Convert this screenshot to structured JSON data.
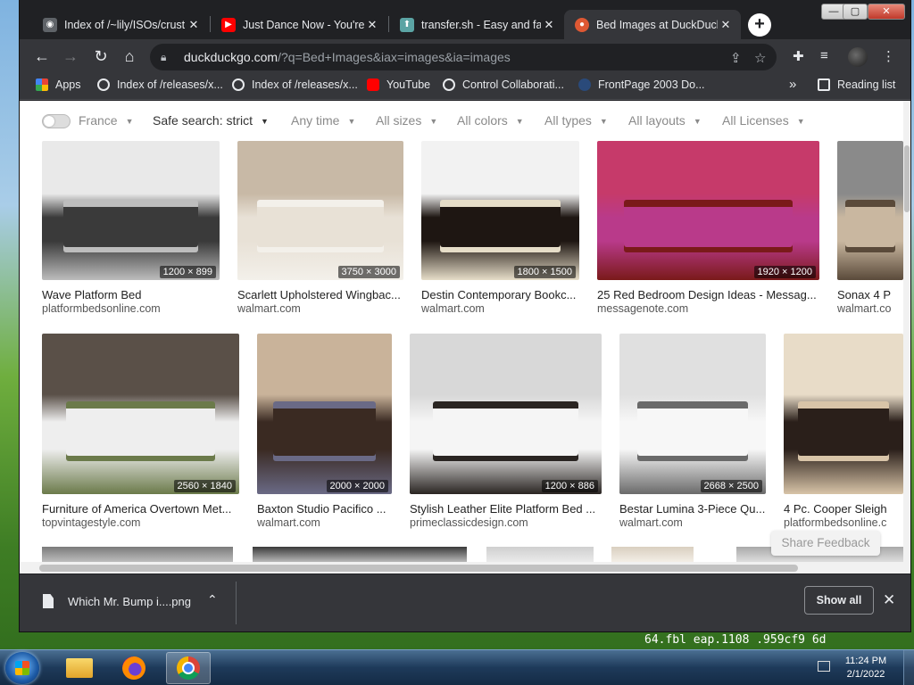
{
  "browser": {
    "tabs": [
      {
        "title": "Index of /~lily/ISOs/crust",
        "favicon_color": "#5f6368",
        "active": false
      },
      {
        "title": "Just Dance Now - You're",
        "favicon_color": "#ff0000",
        "active": false
      },
      {
        "title": "transfer.sh - Easy and fas",
        "favicon_color": "#5ba4a4",
        "active": false
      },
      {
        "title": "Bed Images at DuckDuck",
        "favicon_color": "#de5833",
        "active": true
      }
    ],
    "close_glyph": "✕",
    "new_tab_glyph": "+",
    "url_host": "duckduckgo.com",
    "url_rest": "/?q=Bed+Images&iax=images&ia=images",
    "bookmarks": [
      {
        "label": "Apps",
        "color": "#4285f4"
      },
      {
        "label": "Index of /releases/x...",
        "color": "#e8eaed"
      },
      {
        "label": "Index of /releases/x...",
        "color": "#e8eaed"
      },
      {
        "label": "YouTube",
        "color": "#ff0000"
      },
      {
        "label": "Control Collaborati...",
        "color": "#e8eaed"
      },
      {
        "label": "FrontPage 2003 Do...",
        "color": "#2a4a7a"
      }
    ],
    "bookmarks_overflow": "»",
    "reading_list": "Reading list"
  },
  "filters": {
    "region": "France",
    "safe_search": "Safe search: strict",
    "time": "Any time",
    "sizes": "All sizes",
    "colors": "All colors",
    "types": "All types",
    "layouts": "All layouts",
    "licenses": "All Licenses",
    "caret": "▼"
  },
  "results": [
    {
      "title": "Wave Platform Bed",
      "source": "platformbedsonline.com",
      "size": "1200 × 899",
      "palette": [
        "#e9e9e9",
        "#3a3a3a",
        "#bdbdbd"
      ]
    },
    {
      "title": "Scarlett Upholstered Wingbac...",
      "source": "walmart.com",
      "size": "3750 × 3000",
      "palette": [
        "#c8b9a6",
        "#e8e1d6",
        "#f3f0ea"
      ]
    },
    {
      "title": "Destin Contemporary Bookc...",
      "source": "walmart.com",
      "size": "1800 × 1500",
      "palette": [
        "#f2f2f2",
        "#1e1612",
        "#e6ddc8"
      ]
    },
    {
      "title": "25 Red Bedroom Design Ideas - Messag...",
      "source": "messagenote.com",
      "size": "1920 × 1200",
      "palette": [
        "#c63a6a",
        "#b93a8a",
        "#7a1a1a"
      ]
    },
    {
      "title": "Sonax 4 P",
      "source": "walmart.co",
      "size": "",
      "palette": [
        "#8a8a8a",
        "#c9b7a0",
        "#5a4a3a"
      ]
    },
    {
      "title": "Furniture of America Overtown Met...",
      "source": "topvintagestyle.com",
      "size": "2560 × 1840",
      "palette": [
        "#5a5048",
        "#eeeeee",
        "#6b7a4a"
      ]
    },
    {
      "title": "Baxton Studio Pacifico ...",
      "source": "walmart.com",
      "size": "2000 × 2000",
      "palette": [
        "#c9b39a",
        "#3a2a22",
        "#6a6a86"
      ]
    },
    {
      "title": "Stylish Leather Elite Platform Bed ...",
      "source": "primeclassicdesign.com",
      "size": "1200 × 886",
      "palette": [
        "#d8d8d8",
        "#f5f5f5",
        "#2a2522"
      ]
    },
    {
      "title": "Bestar Lumina 3-Piece Qu...",
      "source": "walmart.com",
      "size": "2668 × 2500",
      "palette": [
        "#e0e0e0",
        "#f7f7f7",
        "#6a6a6a"
      ]
    },
    {
      "title": "4 Pc. Cooper Sleigh",
      "source": "platformbedsonline.c",
      "size": "",
      "palette": [
        "#e8dcc8",
        "#2a1f1a",
        "#d8c4a8"
      ]
    }
  ],
  "share_feedback": "Share Feedback",
  "download": {
    "filename": "Which Mr. Bump i....png",
    "chevron": "⌃",
    "show_all": "Show all",
    "close": "✕"
  },
  "taskbar": {
    "time": "11:24 PM",
    "date": "2/1/2022"
  },
  "desktop": {
    "fragment": "64.fbl  eap.1108  .959cf9  6d"
  },
  "window_controls": {
    "minimize": "—",
    "maximize": "▢",
    "close": "✕"
  }
}
